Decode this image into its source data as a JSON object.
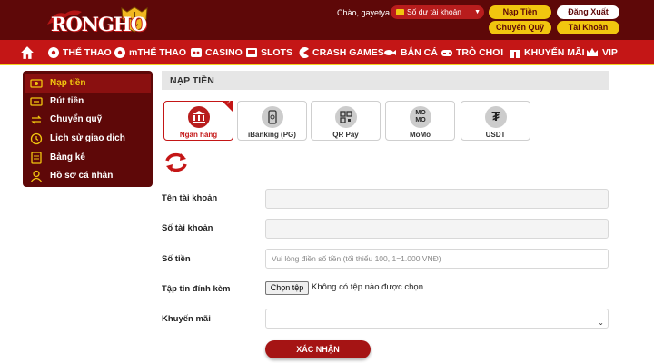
{
  "header": {
    "logo_text": "RONGHO",
    "greeting": "Chào, gayetya",
    "balance_label": "Số dư tài khoản",
    "deposit_label": "Nạp Tiền",
    "logout_label": "Đăng Xuất",
    "transfer_label": "Chuyển Quỹ",
    "account_label": "Tài Khoản"
  },
  "nav": {
    "items": [
      {
        "label": "THỂ THAO",
        "icon": "soccer-ball-icon"
      },
      {
        "label": "mTHỂ THAO",
        "icon": "soccer-ball-icon"
      },
      {
        "label": "CASINO",
        "icon": "casino-icon"
      },
      {
        "label": "SLOTS",
        "icon": "slot-machine-icon"
      },
      {
        "label": "CRASH GAMES",
        "icon": "pacman-icon"
      },
      {
        "label": "BẮN CÁ",
        "icon": "fish-icon"
      },
      {
        "label": "TRÒ CHƠI",
        "icon": "gamepad-icon"
      },
      {
        "label": "KHUYẾN MÃI",
        "icon": "gift-icon"
      },
      {
        "label": "VIP",
        "icon": "crown-icon"
      }
    ]
  },
  "sidebar": {
    "items": [
      {
        "label": "Nạp tiền",
        "icon": "deposit-icon"
      },
      {
        "label": "Rút tiền",
        "icon": "withdraw-icon"
      },
      {
        "label": "Chuyển quỹ",
        "icon": "transfer-icon"
      },
      {
        "label": "Lịch sử giao dịch",
        "icon": "history-icon"
      },
      {
        "label": "Bảng kê",
        "icon": "statement-icon"
      },
      {
        "label": "Hồ sơ cá nhân",
        "icon": "user-icon"
      }
    ]
  },
  "page": {
    "title": "NẠP TIỀN"
  },
  "methods": [
    {
      "label": "Ngân hàng",
      "icon": "bank-icon"
    },
    {
      "label": "iBanking (PG)",
      "icon": "mobile-banking-icon"
    },
    {
      "label": "QR Pay",
      "icon": "qr-code-icon"
    },
    {
      "label": "MoMo",
      "icon": "momo-icon",
      "glyph": "MO\nMO"
    },
    {
      "label": "USDT",
      "icon": "tether-icon",
      "glyph": "₮"
    }
  ],
  "form": {
    "account_name_label": "Tên tài khoản",
    "account_number_label": "Số tài khoản",
    "amount_label": "Số tiền",
    "amount_placeholder": "Vui lòng điền số tiền (tối thiểu 100,  1=1.000 VNĐ)",
    "attachment_label": "Tập tin đính kèm",
    "file_button": "Chọn tệp",
    "file_status": "Không có tệp nào được chọn",
    "promo_label": "Khuyến mãi",
    "submit_label": "XÁC NHẬN"
  },
  "colors": {
    "header_bg": "#5e0808",
    "nav_bg": "#c41616",
    "accent_yellow": "#f1c60f"
  }
}
